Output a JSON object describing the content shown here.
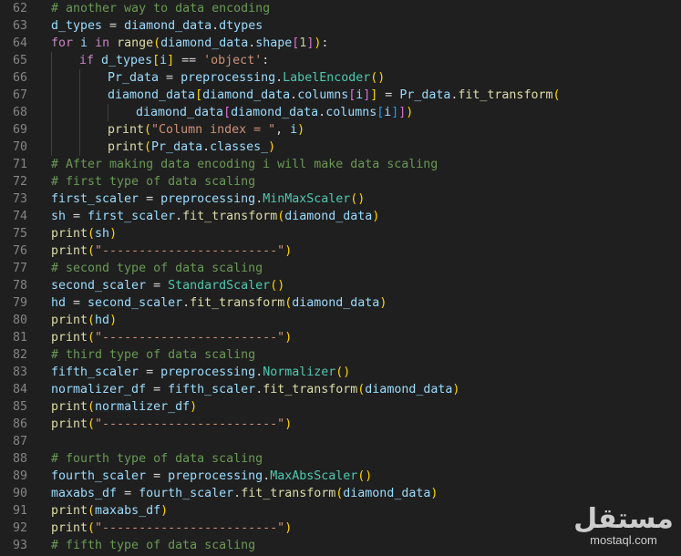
{
  "editor": {
    "language": "python",
    "lines": [
      {
        "n": "62",
        "indent": 0,
        "tokens": [
          [
            "cm",
            "# another way to data encoding"
          ]
        ]
      },
      {
        "n": "63",
        "indent": 0,
        "tokens": [
          [
            "var",
            "d_types"
          ],
          [
            "op",
            " = "
          ],
          [
            "var",
            "diamond_data"
          ],
          [
            "op",
            "."
          ],
          [
            "var",
            "dtypes"
          ]
        ]
      },
      {
        "n": "64",
        "indent": 0,
        "tokens": [
          [
            "kw",
            "for"
          ],
          [
            "op",
            " "
          ],
          [
            "var",
            "i"
          ],
          [
            "op",
            " "
          ],
          [
            "kw",
            "in"
          ],
          [
            "op",
            " "
          ],
          [
            "fn",
            "range"
          ],
          [
            "bk",
            "("
          ],
          [
            "var",
            "diamond_data"
          ],
          [
            "op",
            "."
          ],
          [
            "var",
            "shape"
          ],
          [
            "bk2",
            "["
          ],
          [
            "num",
            "1"
          ],
          [
            "bk2",
            "]"
          ],
          [
            "bk",
            ")"
          ],
          [
            "op",
            ":"
          ]
        ]
      },
      {
        "n": "65",
        "indent": 1,
        "tokens": [
          [
            "kw",
            "if"
          ],
          [
            "op",
            " "
          ],
          [
            "var",
            "d_types"
          ],
          [
            "bk",
            "["
          ],
          [
            "var",
            "i"
          ],
          [
            "bk",
            "]"
          ],
          [
            "op",
            " == "
          ],
          [
            "str",
            "'object'"
          ],
          [
            "op",
            ":"
          ]
        ]
      },
      {
        "n": "66",
        "indent": 2,
        "tokens": [
          [
            "var",
            "Pr_data"
          ],
          [
            "op",
            " = "
          ],
          [
            "var",
            "preprocessing"
          ],
          [
            "op",
            "."
          ],
          [
            "cls",
            "LabelEncoder"
          ],
          [
            "bk",
            "()"
          ]
        ]
      },
      {
        "n": "67",
        "indent": 2,
        "tokens": [
          [
            "var",
            "diamond_data"
          ],
          [
            "bk",
            "["
          ],
          [
            "var",
            "diamond_data"
          ],
          [
            "op",
            "."
          ],
          [
            "var",
            "columns"
          ],
          [
            "bk2",
            "["
          ],
          [
            "var",
            "i"
          ],
          [
            "bk2",
            "]"
          ],
          [
            "bk",
            "]"
          ],
          [
            "op",
            " = "
          ],
          [
            "var",
            "Pr_data"
          ],
          [
            "op",
            "."
          ],
          [
            "fn",
            "fit_transform"
          ],
          [
            "bk",
            "("
          ]
        ]
      },
      {
        "n": "68",
        "indent": 3,
        "tokens": [
          [
            "var",
            "diamond_data"
          ],
          [
            "bk2",
            "["
          ],
          [
            "var",
            "diamond_data"
          ],
          [
            "op",
            "."
          ],
          [
            "var",
            "columns"
          ],
          [
            "bk3",
            "["
          ],
          [
            "var",
            "i"
          ],
          [
            "bk3",
            "]"
          ],
          [
            "bk2",
            "]"
          ],
          [
            "bk",
            ")"
          ]
        ]
      },
      {
        "n": "69",
        "indent": 2,
        "tokens": [
          [
            "fn",
            "print"
          ],
          [
            "bk",
            "("
          ],
          [
            "str",
            "\"Column index = \""
          ],
          [
            "op",
            ", "
          ],
          [
            "var",
            "i"
          ],
          [
            "bk",
            ")"
          ]
        ]
      },
      {
        "n": "70",
        "indent": 2,
        "tokens": [
          [
            "fn",
            "print"
          ],
          [
            "bk",
            "("
          ],
          [
            "var",
            "Pr_data"
          ],
          [
            "op",
            "."
          ],
          [
            "var",
            "classes_"
          ],
          [
            "bk",
            ")"
          ]
        ]
      },
      {
        "n": "71",
        "indent": 0,
        "tokens": [
          [
            "cm",
            "# After making data encoding i will make data scaling"
          ]
        ]
      },
      {
        "n": "72",
        "indent": 0,
        "tokens": [
          [
            "cm",
            "# first type of data scaling"
          ]
        ]
      },
      {
        "n": "73",
        "indent": 0,
        "tokens": [
          [
            "var",
            "first_scaler"
          ],
          [
            "op",
            " = "
          ],
          [
            "var",
            "preprocessing"
          ],
          [
            "op",
            "."
          ],
          [
            "cls",
            "MinMaxScaler"
          ],
          [
            "bk",
            "()"
          ]
        ]
      },
      {
        "n": "74",
        "indent": 0,
        "tokens": [
          [
            "var",
            "sh"
          ],
          [
            "op",
            " = "
          ],
          [
            "var",
            "first_scaler"
          ],
          [
            "op",
            "."
          ],
          [
            "fn",
            "fit_transform"
          ],
          [
            "bk",
            "("
          ],
          [
            "var",
            "diamond_data"
          ],
          [
            "bk",
            ")"
          ]
        ]
      },
      {
        "n": "75",
        "indent": 0,
        "tokens": [
          [
            "fn",
            "print"
          ],
          [
            "bk",
            "("
          ],
          [
            "var",
            "sh"
          ],
          [
            "bk",
            ")"
          ]
        ]
      },
      {
        "n": "76",
        "indent": 0,
        "tokens": [
          [
            "fn",
            "print"
          ],
          [
            "bk",
            "("
          ],
          [
            "str",
            "\"------------------------\""
          ],
          [
            "bk",
            ")"
          ]
        ]
      },
      {
        "n": "77",
        "indent": 0,
        "tokens": [
          [
            "cm",
            "# second type of data scaling"
          ]
        ]
      },
      {
        "n": "78",
        "indent": 0,
        "tokens": [
          [
            "var",
            "second_scaler"
          ],
          [
            "op",
            " = "
          ],
          [
            "cls",
            "StandardScaler"
          ],
          [
            "bk",
            "()"
          ]
        ]
      },
      {
        "n": "79",
        "indent": 0,
        "tokens": [
          [
            "var",
            "hd"
          ],
          [
            "op",
            " = "
          ],
          [
            "var",
            "second_scaler"
          ],
          [
            "op",
            "."
          ],
          [
            "fn",
            "fit_transform"
          ],
          [
            "bk",
            "("
          ],
          [
            "var",
            "diamond_data"
          ],
          [
            "bk",
            ")"
          ]
        ]
      },
      {
        "n": "80",
        "indent": 0,
        "tokens": [
          [
            "fn",
            "print"
          ],
          [
            "bk",
            "("
          ],
          [
            "var",
            "hd"
          ],
          [
            "bk",
            ")"
          ]
        ]
      },
      {
        "n": "81",
        "indent": 0,
        "tokens": [
          [
            "fn",
            "print"
          ],
          [
            "bk",
            "("
          ],
          [
            "str",
            "\"------------------------\""
          ],
          [
            "bk",
            ")"
          ]
        ]
      },
      {
        "n": "82",
        "indent": 0,
        "tokens": [
          [
            "cm",
            "# third type of data scaling"
          ]
        ]
      },
      {
        "n": "83",
        "indent": 0,
        "tokens": [
          [
            "var",
            "fifth_scaler"
          ],
          [
            "op",
            " = "
          ],
          [
            "var",
            "preprocessing"
          ],
          [
            "op",
            "."
          ],
          [
            "cls",
            "Normalizer"
          ],
          [
            "bk",
            "()"
          ]
        ]
      },
      {
        "n": "84",
        "indent": 0,
        "tokens": [
          [
            "var",
            "normalizer_df"
          ],
          [
            "op",
            " = "
          ],
          [
            "var",
            "fifth_scaler"
          ],
          [
            "op",
            "."
          ],
          [
            "fn",
            "fit_transform"
          ],
          [
            "bk",
            "("
          ],
          [
            "var",
            "diamond_data"
          ],
          [
            "bk",
            ")"
          ]
        ]
      },
      {
        "n": "85",
        "indent": 0,
        "tokens": [
          [
            "fn",
            "print"
          ],
          [
            "bk",
            "("
          ],
          [
            "var",
            "normalizer_df"
          ],
          [
            "bk",
            ")"
          ]
        ]
      },
      {
        "n": "86",
        "indent": 0,
        "tokens": [
          [
            "fn",
            "print"
          ],
          [
            "bk",
            "("
          ],
          [
            "str",
            "\"------------------------\""
          ],
          [
            "bk",
            ")"
          ]
        ]
      },
      {
        "n": "87",
        "indent": 0,
        "tokens": []
      },
      {
        "n": "88",
        "indent": 0,
        "tokens": [
          [
            "cm",
            "# fourth type of data scaling"
          ]
        ]
      },
      {
        "n": "89",
        "indent": 0,
        "tokens": [
          [
            "var",
            "fourth_scaler"
          ],
          [
            "op",
            " = "
          ],
          [
            "var",
            "preprocessing"
          ],
          [
            "op",
            "."
          ],
          [
            "cls",
            "MaxAbsScaler"
          ],
          [
            "bk",
            "()"
          ]
        ]
      },
      {
        "n": "90",
        "indent": 0,
        "tokens": [
          [
            "var",
            "maxabs_df"
          ],
          [
            "op",
            " = "
          ],
          [
            "var",
            "fourth_scaler"
          ],
          [
            "op",
            "."
          ],
          [
            "fn",
            "fit_transform"
          ],
          [
            "bk",
            "("
          ],
          [
            "var",
            "diamond_data"
          ],
          [
            "bk",
            ")"
          ]
        ]
      },
      {
        "n": "91",
        "indent": 0,
        "tokens": [
          [
            "fn",
            "print"
          ],
          [
            "bk",
            "("
          ],
          [
            "var",
            "maxabs_df"
          ],
          [
            "bk",
            ")"
          ]
        ]
      },
      {
        "n": "92",
        "indent": 0,
        "tokens": [
          [
            "fn",
            "print"
          ],
          [
            "bk",
            "("
          ],
          [
            "str",
            "\"------------------------\""
          ],
          [
            "bk",
            ")"
          ]
        ]
      },
      {
        "n": "93",
        "indent": 0,
        "tokens": [
          [
            "cm",
            "# fifth type of data scaling"
          ]
        ]
      }
    ]
  },
  "watermark": {
    "logo_text": "مستقل",
    "url": "mostaql.com"
  },
  "colors": {
    "background": "#1f1f1f",
    "line_number": "#858585",
    "comment": "#6a9955",
    "keyword": "#c586c0",
    "function": "#dcdcaa",
    "variable": "#9cdcfe",
    "string": "#ce9178",
    "number": "#b5cea8",
    "class": "#4ec9b0"
  }
}
